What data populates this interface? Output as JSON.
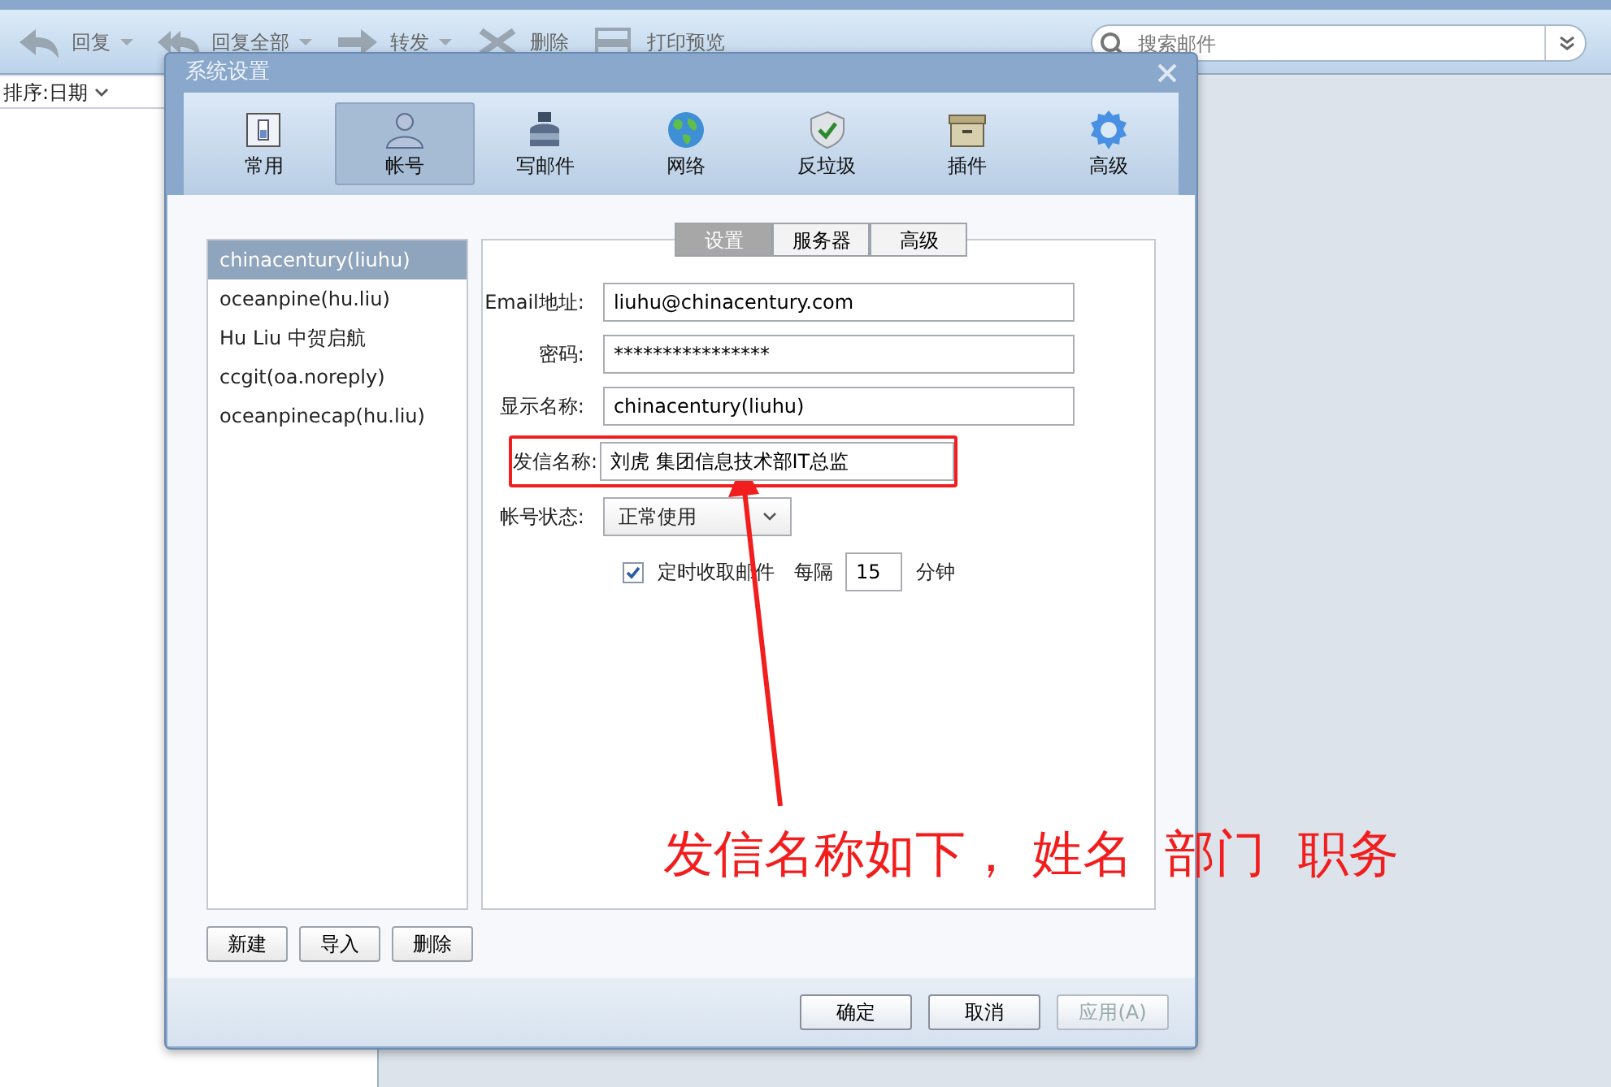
{
  "toolbar": {
    "items": [
      {
        "label": "回复",
        "menu": true
      },
      {
        "label": "回复全部",
        "menu": true
      },
      {
        "label": "转发",
        "menu": true
      },
      {
        "label": "删除",
        "menu": false
      },
      {
        "label": "打印预览",
        "menu": false
      }
    ],
    "search": {
      "placeholder": "搜索邮件"
    }
  },
  "message_list": {
    "sort_label": "排序:日期"
  },
  "dialog": {
    "title": "系统设置",
    "categories": [
      {
        "label": "常用",
        "selected": false
      },
      {
        "label": "帐号",
        "selected": true
      },
      {
        "label": "写邮件",
        "selected": false
      },
      {
        "label": "网络",
        "selected": false
      },
      {
        "label": "反垃圾",
        "selected": false
      },
      {
        "label": "插件",
        "selected": false
      },
      {
        "label": "高级",
        "selected": false
      }
    ],
    "accounts": [
      {
        "name": "chinacentury(liuhu)",
        "selected": true
      },
      {
        "name": "oceanpine(hu.liu)",
        "selected": false
      },
      {
        "name": "Hu Liu 中贺启航",
        "selected": false
      },
      {
        "name": "ccgit(oa.noreply)",
        "selected": false
      },
      {
        "name": "oceanpinecap(hu.liu)",
        "selected": false
      }
    ],
    "account_buttons": [
      "新建",
      "导入",
      "删除"
    ],
    "tabs": [
      {
        "label": "设置",
        "selected": true
      },
      {
        "label": "服务器",
        "selected": false
      },
      {
        "label": "高级",
        "selected": false
      }
    ],
    "fields": [
      {
        "label": "Email地址:",
        "value": "liuhu@chinacentury.com",
        "highlighted": false
      },
      {
        "label": "密码:",
        "value": "****************",
        "highlighted": false
      },
      {
        "label": "显示名称:",
        "value": "chinacentury(liuhu)",
        "highlighted": false
      },
      {
        "label": "发信名称:",
        "value": "刘虎 集团信息技术部IT总监",
        "highlighted": true
      }
    ],
    "status": {
      "label": "帐号状态:",
      "value": "正常使用"
    },
    "auto_fetch": {
      "label": "定时收取邮件",
      "checked": true,
      "interval_label": "每隔",
      "interval": "15",
      "unit": "分钟"
    },
    "buttons": [
      {
        "label": "确定",
        "disabled": false
      },
      {
        "label": "取消",
        "disabled": false
      },
      {
        "label": "应用(A)",
        "disabled": true
      }
    ]
  },
  "annotation": {
    "text": "发信名称如下， 姓名  部门  职务"
  }
}
